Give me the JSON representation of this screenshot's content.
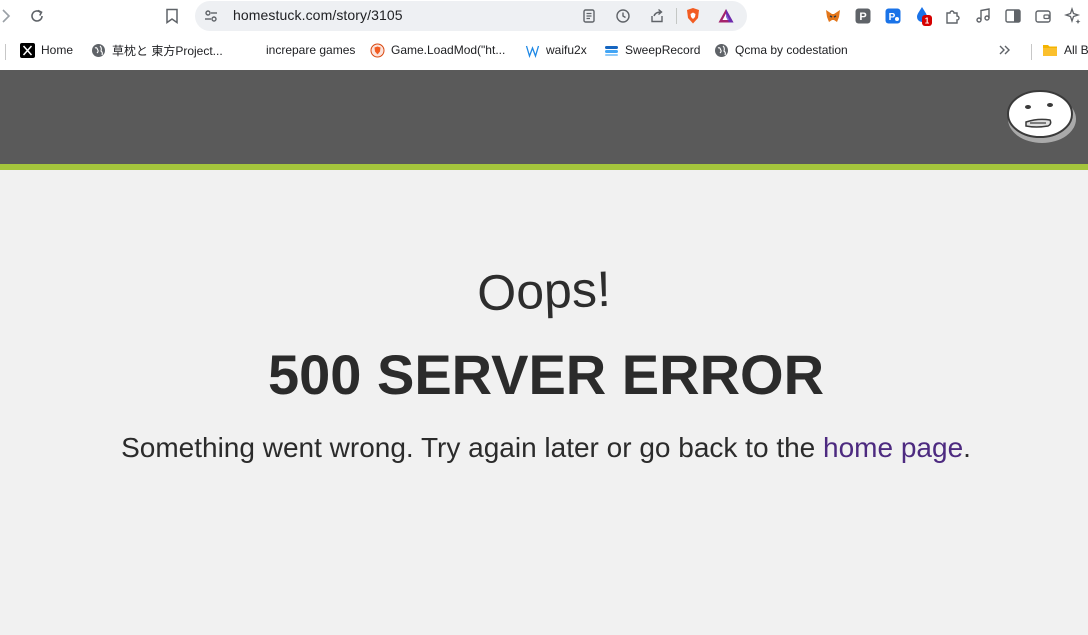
{
  "browser": {
    "url": "homestuck.com/story/3105",
    "bookmarks": [
      {
        "label": "Home",
        "icon": "x-logo-icon"
      },
      {
        "label": "草枕と 東方Project...",
        "icon": "globe-icon"
      },
      {
        "label": "increpare games",
        "icon": ""
      },
      {
        "label": "Game.LoadMod(\"ht...",
        "icon": "shield-icon"
      },
      {
        "label": "waifu2x",
        "icon": "w-icon"
      },
      {
        "label": "SweepRecord",
        "icon": "stack-icon"
      },
      {
        "label": "Qcma by codestation",
        "icon": "globe-icon"
      }
    ],
    "all_bookmarks_label": "All B",
    "extension_badge": "1"
  },
  "colors": {
    "header": "#5a5a5a",
    "accent_stripe": "#a5c53c",
    "link": "#4d2a80",
    "text": "#2b2b2b"
  },
  "page": {
    "oops": "Oops!",
    "error_title": "500 SERVER ERROR",
    "message_prefix": "Something went wrong. Try again later or go back to the ",
    "home_link": "home page",
    "message_suffix": "."
  }
}
